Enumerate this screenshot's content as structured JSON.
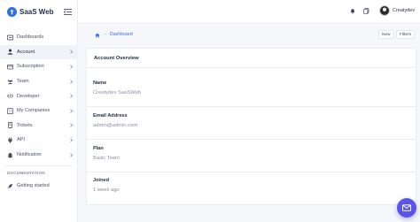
{
  "brand": {
    "name": "SaaS Web"
  },
  "sidebar": {
    "items": [
      {
        "label": "Dashboards",
        "icon": "dashboard-icon",
        "active": false,
        "has_chevron": false
      },
      {
        "label": "Account",
        "icon": "user-icon",
        "active": true,
        "has_chevron": true
      },
      {
        "label": "Subscription",
        "icon": "card-icon",
        "active": false,
        "has_chevron": true
      },
      {
        "label": "Team",
        "icon": "team-icon",
        "active": false,
        "has_chevron": true
      },
      {
        "label": "Developer",
        "icon": "code-icon",
        "active": false,
        "has_chevron": true
      },
      {
        "label": "My Companies",
        "icon": "building-icon",
        "active": false,
        "has_chevron": true
      },
      {
        "label": "Tickets",
        "icon": "ticket-icon",
        "active": false,
        "has_chevron": true
      },
      {
        "label": "API",
        "icon": "plug-icon",
        "active": false,
        "has_chevron": true
      },
      {
        "label": "Notification",
        "icon": "bell-icon",
        "active": false,
        "has_chevron": true
      }
    ],
    "section_title": "DOCUMENTATION",
    "bottom_items": [
      {
        "label": "Getting started",
        "icon": "rocket-icon"
      }
    ]
  },
  "topbar": {
    "user_name": "Creatydev",
    "icons": [
      "bell-icon",
      "document-icon",
      "avatar"
    ]
  },
  "breadcrumb": {
    "home_icon": "home-icon",
    "current": "Dashboard"
  },
  "actions": {
    "new_label": "New",
    "filters_label": "Filters"
  },
  "card": {
    "title": "Account Overview",
    "fields": [
      {
        "label": "Name",
        "value": "Creatydev SaaSWeb"
      },
      {
        "label": "Email Address",
        "value": "admin@admin.com"
      },
      {
        "label": "Plan",
        "value": "Basic Team"
      },
      {
        "label": "Joined",
        "value": "1 week ago"
      }
    ]
  },
  "fab": {
    "icon": "mail-icon"
  },
  "colors": {
    "accent": "#3c6fe0",
    "fab": "#5a55e8",
    "brand": "#2f6fe4"
  }
}
